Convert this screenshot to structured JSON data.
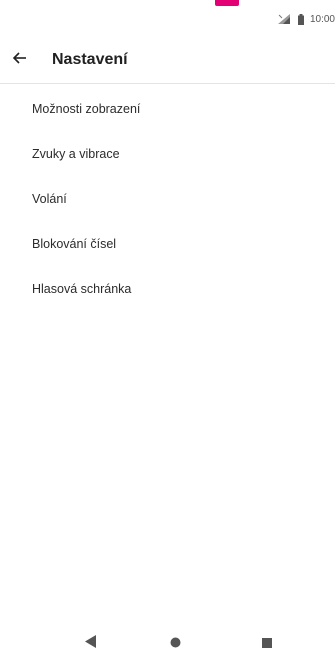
{
  "status_bar": {
    "time": "10:00",
    "icons": [
      "signal-icon",
      "battery-icon"
    ]
  },
  "header": {
    "back_icon": "arrow-left-icon",
    "title": "Nastavení"
  },
  "menu": {
    "items": [
      {
        "label": "Možnosti zobrazení"
      },
      {
        "label": "Zvuky a vibrace"
      },
      {
        "label": "Volání"
      },
      {
        "label": "Blokování čísel"
      },
      {
        "label": "Hlasová schránka"
      }
    ]
  },
  "nav_bar": {
    "icons": [
      "back-triangle-icon",
      "home-circle-icon",
      "recents-square-icon"
    ]
  },
  "colors": {
    "accent": "#e20074",
    "text": "#212121",
    "divider": "#e4e4e4"
  }
}
